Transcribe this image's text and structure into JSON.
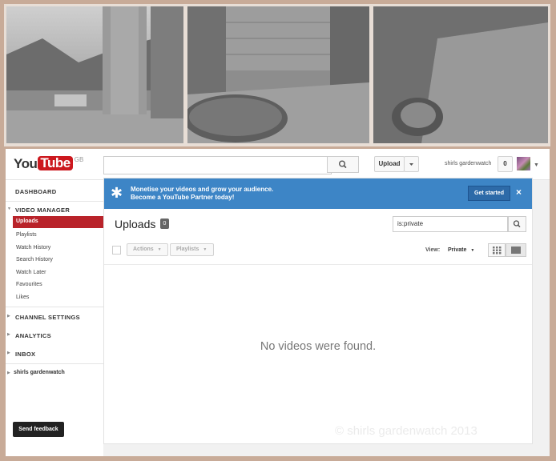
{
  "header": {
    "logo_you": "You",
    "logo_tube": "Tube",
    "logo_region": "GB",
    "search_placeholder": "",
    "upload_label": "Upload",
    "username": "shirls gardenwatch",
    "notification_count": "0"
  },
  "sidebar": {
    "dashboard": "DASHBOARD",
    "video_manager": "VIDEO MANAGER",
    "items": [
      "Uploads",
      "Playlists",
      "Watch History",
      "Search History",
      "Watch Later",
      "Favourites",
      "Likes"
    ],
    "channel_settings": "CHANNEL SETTINGS",
    "analytics": "ANALYTICS",
    "inbox": "INBOX",
    "channel_name": "shirls gardenwatch",
    "feedback": "Send feedback"
  },
  "banner": {
    "line1": "Monetise your videos and grow your audience.",
    "line2": "Become a YouTube Partner today!",
    "cta": "Get started",
    "close": "×"
  },
  "uploads": {
    "title": "Uploads",
    "count": "0",
    "filter_value": "is:private",
    "actions_label": "Actions",
    "playlists_label": "Playlists",
    "view_label": "View:",
    "view_value": "Private",
    "empty_message": "No videos were found.",
    "watermark": "© shirls gardenwatch 2013"
  },
  "colors": {
    "brand_red": "#cc181e",
    "selected_nav": "#b9232a",
    "banner_blue": "#3d85c6",
    "frame_bg": "#c8ab98"
  }
}
